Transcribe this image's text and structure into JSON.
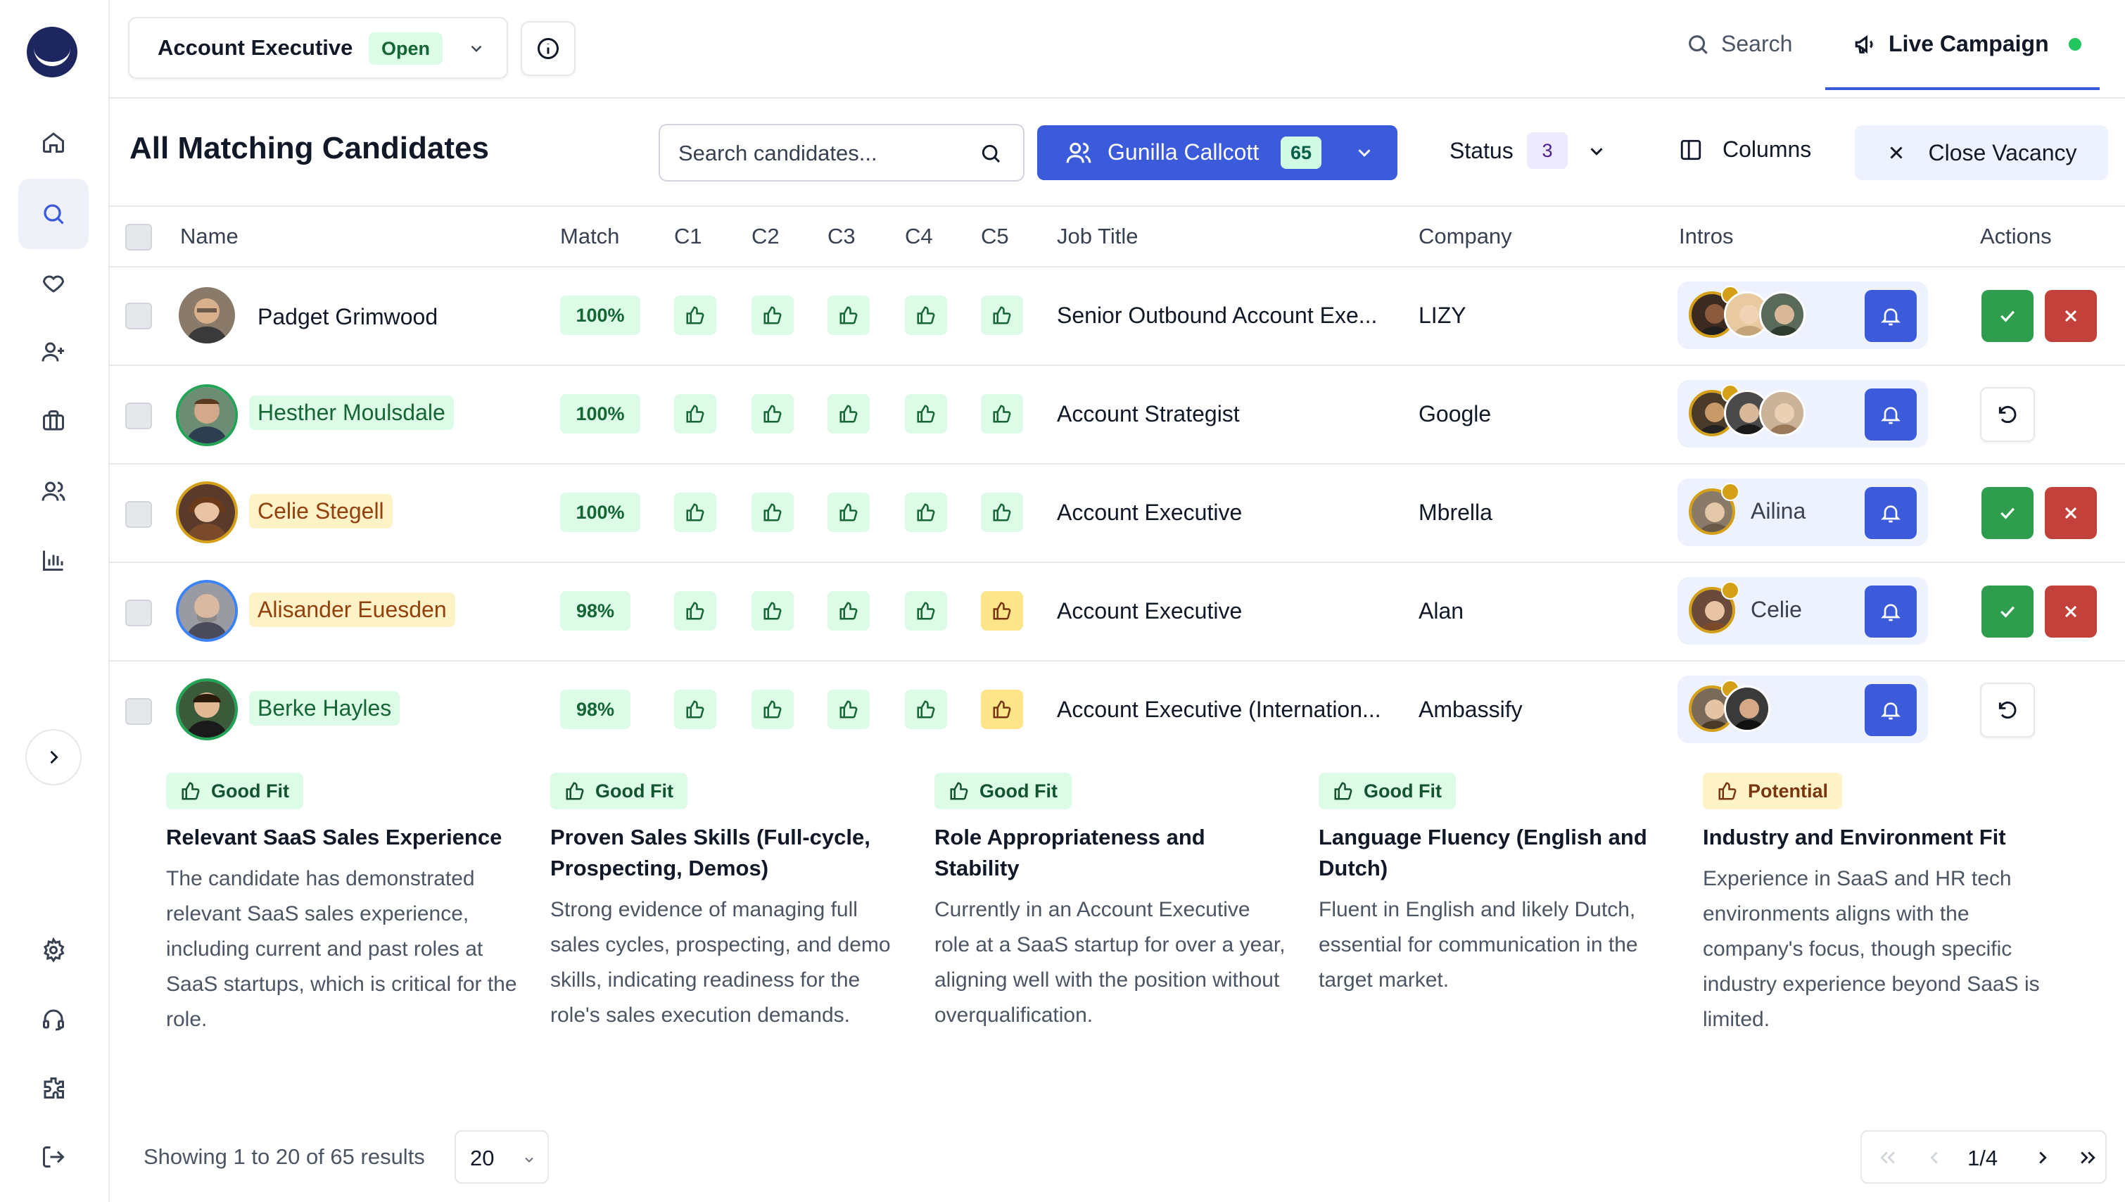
{
  "header": {
    "job_title": "Account Executive",
    "job_status": "Open",
    "search_label": "Search",
    "campaign_label": "Live Campaign"
  },
  "toolbar": {
    "page_title": "All Matching Candidates",
    "search_placeholder": "Search candidates...",
    "user_name": "Gunilla Callcott",
    "user_count": "65",
    "status_label": "Status",
    "status_count": "3",
    "columns_label": "Columns",
    "close_vacancy_label": "Close Vacancy"
  },
  "table": {
    "columns": [
      "Name",
      "Match",
      "C1",
      "C2",
      "C3",
      "C4",
      "C5",
      "Job Title",
      "Company",
      "Intros",
      "Actions"
    ],
    "rows": [
      {
        "name": "Padget Grimwood",
        "match": "100%",
        "job_title": "Senior Outbound Account Exe...",
        "company": "LIZY",
        "intro_name": ""
      },
      {
        "name": "Hesther Moulsdale",
        "match": "100%",
        "job_title": "Account Strategist",
        "company": "Google",
        "intro_name": ""
      },
      {
        "name": "Celie Stegell",
        "match": "100%",
        "job_title": "Account Executive",
        "company": "Mbrella",
        "intro_name": "Ailina"
      },
      {
        "name": "Alisander Euesden",
        "match": "98%",
        "job_title": "Account Executive",
        "company": "Alan",
        "intro_name": "Celie"
      },
      {
        "name": "Berke Hayles",
        "match": "98%",
        "job_title": "Account Executive (Internation...",
        "company": "Ambassify",
        "intro_name": ""
      }
    ]
  },
  "criteria": [
    {
      "badge": "Good Fit",
      "title": "Relevant SaaS Sales Experience",
      "desc": "The candidate has demonstrated relevant SaaS sales experience, including current and past roles at SaaS startups, which is critical for the role."
    },
    {
      "badge": "Good Fit",
      "title": "Proven Sales Skills (Full-cycle, Prospecting, Demos)",
      "desc": "Strong evidence of managing full sales cycles, prospecting, and demo skills, indicating readiness for the role's sales execution demands."
    },
    {
      "badge": "Good Fit",
      "title": "Role Appropriateness and Stability",
      "desc": "Currently in an Account Executive role at a SaaS startup for over a year, aligning well with the position without overqualification."
    },
    {
      "badge": "Good Fit",
      "title": "Language Fluency (English and Dutch)",
      "desc": "Fluent in English and likely Dutch, essential for communication in the target market."
    },
    {
      "badge": "Potential",
      "title": "Industry and Environment Fit",
      "desc": "Experience in SaaS and HR tech environments aligns with the company's focus, though specific industry experience beyond SaaS is limited."
    }
  ],
  "footer": {
    "showing": "Showing 1 to 20 of 65 results",
    "per_page": "20",
    "page_indicator": "1/4"
  },
  "colors": {
    "accent": "#3b5bdb",
    "good": "#dcfce7",
    "potential": "#fef3c7",
    "approve": "#2e9d4e",
    "reject": "#c2413a"
  }
}
